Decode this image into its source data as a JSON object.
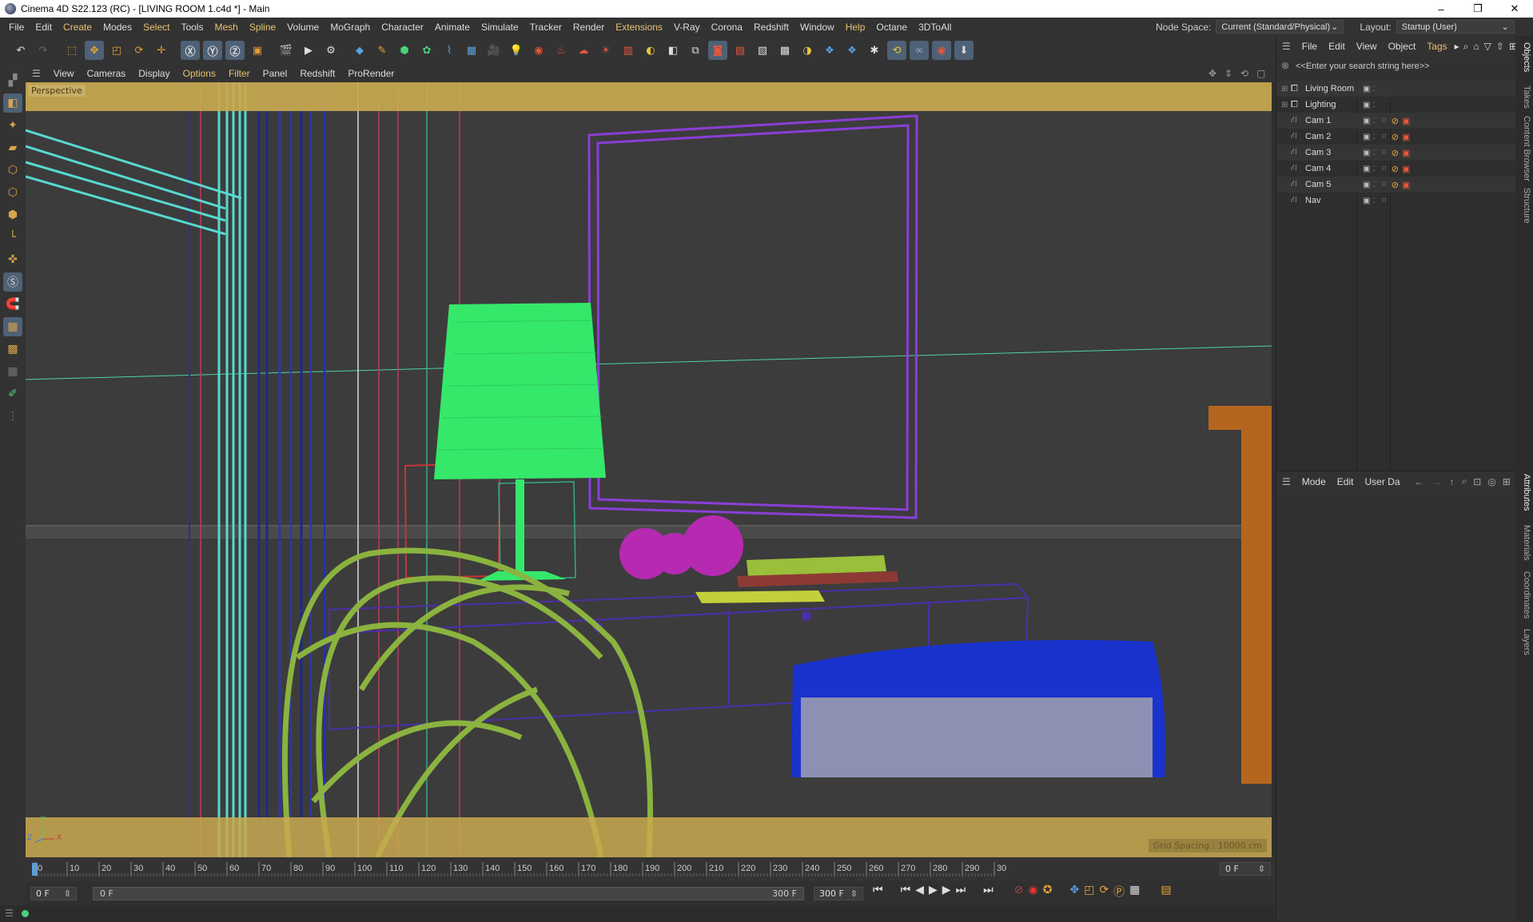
{
  "window": {
    "title": "Cinema 4D S22.123 (RC) - [LIVING ROOM 1.c4d *] - Main",
    "minimize": "–",
    "restore": "❐",
    "close": "✕"
  },
  "menubar": {
    "items": [
      {
        "label": "File"
      },
      {
        "label": "Edit"
      },
      {
        "label": "Create"
      },
      {
        "label": "Modes"
      },
      {
        "label": "Select"
      },
      {
        "label": "Tools"
      },
      {
        "label": "Mesh"
      },
      {
        "label": "Spline"
      },
      {
        "label": "Volume"
      },
      {
        "label": "MoGraph"
      },
      {
        "label": "Character"
      },
      {
        "label": "Animate"
      },
      {
        "label": "Simulate"
      },
      {
        "label": "Tracker"
      },
      {
        "label": "Render"
      },
      {
        "label": "Extensions"
      },
      {
        "label": "V-Ray"
      },
      {
        "label": "Corona"
      },
      {
        "label": "Redshift"
      },
      {
        "label": "Window"
      },
      {
        "label": "Help"
      },
      {
        "label": "Octane"
      },
      {
        "label": "3DToAll"
      }
    ],
    "node_space_label": "Node Space:",
    "node_space_value": "Current (Standard/Physical)",
    "layout_label": "Layout:",
    "layout_value": "Startup (User)"
  },
  "viewport": {
    "menu": [
      {
        "label": "View"
      },
      {
        "label": "Cameras"
      },
      {
        "label": "Display"
      },
      {
        "label": "Options"
      },
      {
        "label": "Filter"
      },
      {
        "label": "Panel"
      },
      {
        "label": "Redshift"
      },
      {
        "label": "ProRender"
      }
    ],
    "label": "Perspective",
    "grid_spacing": "Grid Spacing : 10000 cm",
    "axis_y": "Y",
    "axis_z": "Z",
    "axis_x": "X"
  },
  "timeline": {
    "ticks": [
      "0",
      "10",
      "20",
      "30",
      "40",
      "50",
      "60",
      "70",
      "80",
      "90",
      "100",
      "110",
      "120",
      "130",
      "140",
      "150",
      "160",
      "170",
      "180",
      "190",
      "200",
      "210",
      "220",
      "230",
      "240",
      "250",
      "260",
      "270",
      "280",
      "290",
      "30"
    ],
    "current_frame": "0 F"
  },
  "transport": {
    "start_field": "0 F",
    "range_start": "0 F",
    "range_end": "300 F",
    "end_field": "300 F"
  },
  "objects_panel": {
    "menu": [
      {
        "label": "File"
      },
      {
        "label": "Edit"
      },
      {
        "label": "View"
      },
      {
        "label": "Object"
      },
      {
        "label": "Tags"
      }
    ],
    "search_placeholder": "<<Enter your search string here>>",
    "items": [
      {
        "label": "Living Room"
      },
      {
        "label": "Lighting"
      },
      {
        "label": "Cam 1"
      },
      {
        "label": "Cam 2"
      },
      {
        "label": "Cam 3"
      },
      {
        "label": "Cam 4"
      },
      {
        "label": "Cam 5"
      },
      {
        "label": "Nav"
      }
    ]
  },
  "attributes_panel": {
    "menu": [
      {
        "label": "Mode"
      },
      {
        "label": "Edit"
      },
      {
        "label": "User Da"
      }
    ]
  },
  "side_tabs": {
    "top": [
      "Objects",
      "Takes",
      "Content Browser",
      "Structure"
    ],
    "bottom": [
      "Attributes",
      "Materials",
      "Coordinates",
      "Layers"
    ]
  },
  "colors": {
    "accent": "#e8c370",
    "safe_frame": "#c9a94f",
    "lamp": "#35e86a",
    "chair": "#8bb33f",
    "frame": "#8a3fd6",
    "table": "#4b2fa8",
    "sofa": "#1933cc",
    "balls": "#b52ab0"
  }
}
